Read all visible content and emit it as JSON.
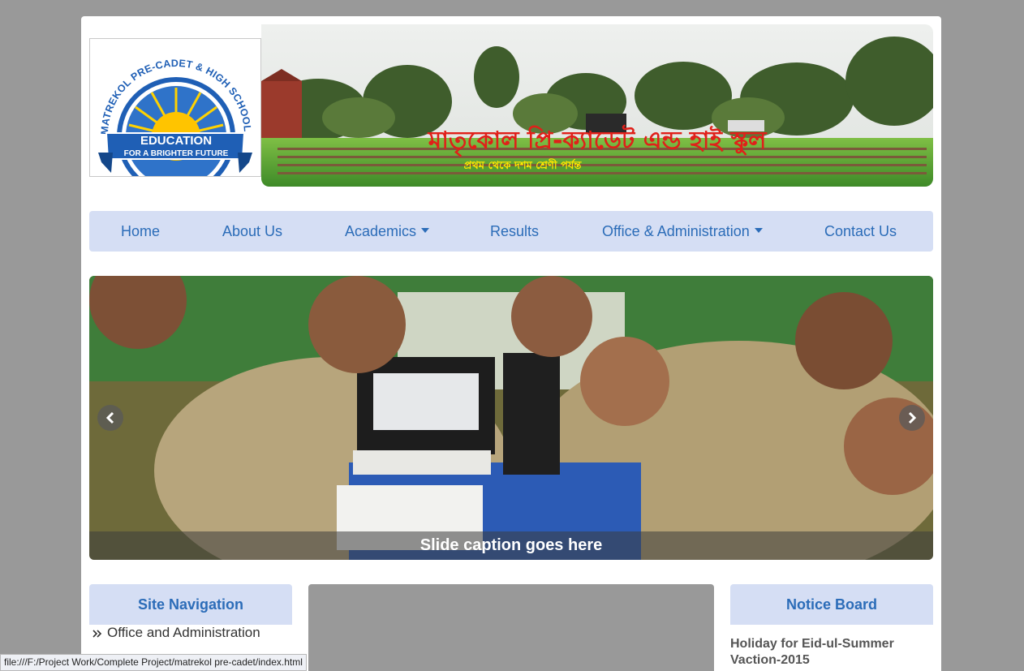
{
  "logo": {
    "arc_text": "MATREKOL PRE-CADET & HIGH SCHOOL",
    "ribbon_line1": "EDUCATION",
    "ribbon_line2": "FOR A BRIGHTER FUTURE"
  },
  "banner": {
    "title": "মাতৃকোল প্রি-ক্যাডেট এন্ড হাই স্কুল",
    "subtitle": "প্রথম থেকে দশম শ্রেণী পর্যন্ত"
  },
  "nav": {
    "items": [
      {
        "label": "Home"
      },
      {
        "label": "About Us"
      },
      {
        "label": "Academics"
      },
      {
        "label": "Results"
      },
      {
        "label": "Office & Administration"
      },
      {
        "label": "Contact Us"
      }
    ]
  },
  "slider": {
    "caption": "Slide caption goes here"
  },
  "site_navigation": {
    "title": "Site Navigation",
    "items": [
      {
        "label": "Office and Administration"
      }
    ]
  },
  "notice_board": {
    "title": "Notice Board",
    "items": [
      {
        "title": "Holiday for Eid-ul-Summer Vaction-2015"
      }
    ]
  },
  "status_bar": {
    "url": "file:///F:/Project Work/Complete Project/matrekol pre-cadet/index.html"
  },
  "colors": {
    "accent": "#2b6cb8",
    "nav_bg": "#d5def4",
    "page_bg": "#999999",
    "banner_title": "#e0201a",
    "banner_subtitle": "#ffe600"
  }
}
